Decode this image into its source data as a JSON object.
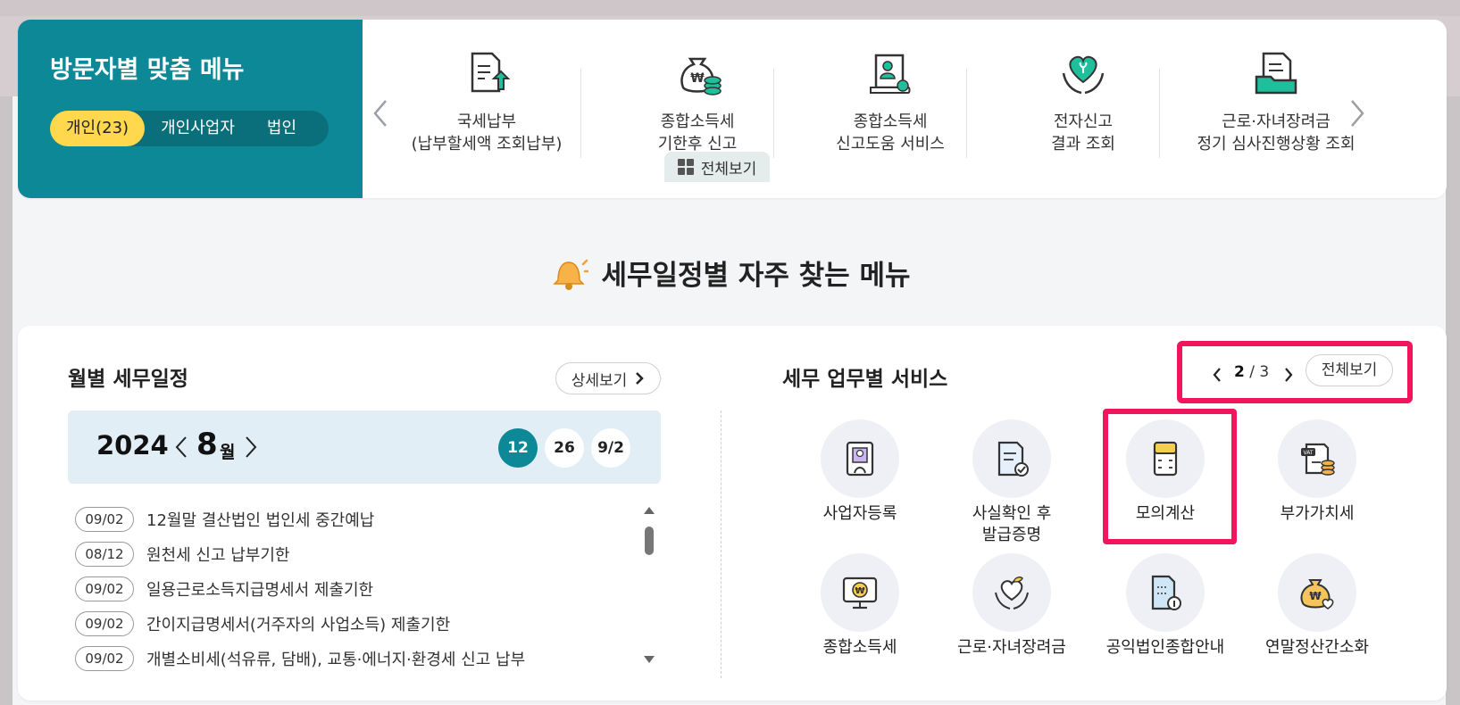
{
  "visitor": {
    "title": "방문자별 맞춤 메뉴",
    "tabs": [
      {
        "label": "개인(23)",
        "active": true
      },
      {
        "label": "개인사업자",
        "active": false
      },
      {
        "label": "법인",
        "active": false
      }
    ],
    "quick_menu": [
      {
        "icon": "document-upload-icon",
        "line1": "국세납부",
        "line2": "(납부할세액 조회납부)"
      },
      {
        "icon": "money-bag-coins-icon",
        "line1": "종합소득세",
        "line2": "기한후 신고"
      },
      {
        "icon": "certificate-scroll-icon",
        "line1": "종합소득세",
        "line2": "신고도움 서비스"
      },
      {
        "icon": "heart-hands-icon",
        "line1": "전자신고",
        "line2": "결과 조회"
      },
      {
        "icon": "folder-document-icon",
        "line1": "근로·자녀장려금",
        "line2": "정기 심사진행상황 조회"
      }
    ],
    "view_all": "전체보기"
  },
  "section_title": "세무일정별 자주 찾는 메뉴",
  "calendar": {
    "title": "월별 세무일정",
    "detail_button": "상세보기",
    "year": "2024",
    "month": "8",
    "month_unit": "월",
    "day_chips": [
      {
        "label": "12",
        "active": true
      },
      {
        "label": "26",
        "active": false
      },
      {
        "label": "9/2",
        "active": false
      }
    ],
    "schedule": [
      {
        "date": "09/02",
        "text": "12월말 결산법인 법인세 중간예납"
      },
      {
        "date": "08/12",
        "text": "원천세 신고 납부기한"
      },
      {
        "date": "09/02",
        "text": "일용근로소득지급명세서 제출기한"
      },
      {
        "date": "09/02",
        "text": "간이지급명세서(거주자의 사업소득) 제출기한"
      },
      {
        "date": "09/02",
        "text": "개별소비세(석유류, 담배), 교통·에너지·환경세 신고 납부"
      }
    ]
  },
  "services": {
    "title": "세무 업무별 서비스",
    "page_current": "2",
    "page_sep": "/",
    "page_total": "3",
    "view_all": "전체보기",
    "items": [
      {
        "icon": "business-registration-icon",
        "line1": "사업자등록",
        "line2": ""
      },
      {
        "icon": "certificate-check-icon",
        "line1": "사실확인 후",
        "line2": "발급증명"
      },
      {
        "icon": "calculator-icon",
        "line1": "모의계산",
        "line2": ""
      },
      {
        "icon": "vat-coins-icon",
        "line1": "부가가치세",
        "line2": ""
      },
      {
        "icon": "monitor-won-icon",
        "line1": "종합소득세",
        "line2": ""
      },
      {
        "icon": "heart-sprout-hands-icon",
        "line1": "근로·자녀장려금",
        "line2": ""
      },
      {
        "icon": "public-building-info-icon",
        "line1": "공익법인종합안내",
        "line2": ""
      },
      {
        "icon": "money-bag-heart-icon",
        "line1": "연말정산간소화",
        "line2": ""
      }
    ]
  },
  "colors": {
    "teal": "#0c8896",
    "yellow": "#ffd84d",
    "highlight": "#f2145c"
  }
}
